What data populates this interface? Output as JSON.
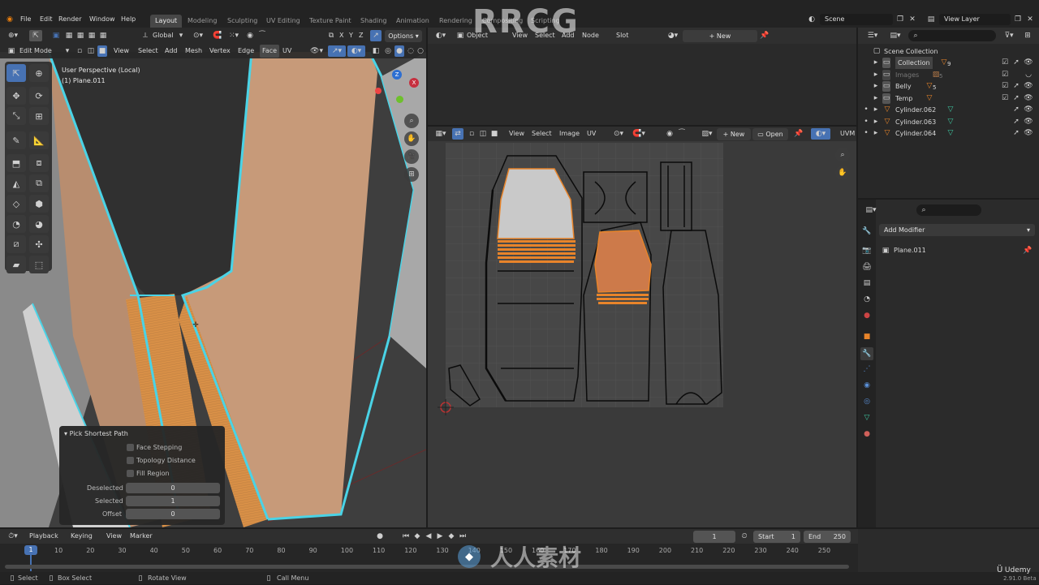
{
  "topbar": {
    "menus": [
      "File",
      "Edit",
      "Render",
      "Window",
      "Help"
    ],
    "tabs": [
      "Layout",
      "Modeling",
      "Sculpting",
      "UV Editing",
      "Texture Paint",
      "Shading",
      "Animation",
      "Rendering",
      "Compositing",
      "Scripting"
    ],
    "active_tab": "Layout",
    "scene": "Scene",
    "view_layer": "View Layer"
  },
  "viewport": {
    "transform_orientation": "Global",
    "options_label": "Options",
    "snap_axes": [
      "X",
      "Y",
      "Z"
    ],
    "mode": "Edit Mode",
    "menus": [
      "View",
      "Select",
      "Add",
      "Mesh",
      "Vertex",
      "Edge",
      "Face",
      "UV"
    ],
    "overlay_title": "User Perspective (Local)",
    "overlay_object": "(1) Plane.011"
  },
  "shader_editor": {
    "type": "Object",
    "menus": [
      "View",
      "Select",
      "Add",
      "Node"
    ],
    "slot_label": "Slot",
    "new_label": "New"
  },
  "uv_editor": {
    "menus": [
      "View",
      "Select",
      "Image",
      "UV"
    ],
    "new_label": "New",
    "open_label": "Open",
    "uv_map": "UVM"
  },
  "operator_panel": {
    "title": "Pick Shortest Path",
    "checkboxes": [
      "Face Stepping",
      "Topology Distance",
      "Fill Region"
    ],
    "fields": [
      {
        "label": "Deselected",
        "value": "0"
      },
      {
        "label": "Selected",
        "value": "1"
      },
      {
        "label": "Offset",
        "value": "0"
      }
    ]
  },
  "outliner": {
    "root": "Scene Collection",
    "items": [
      {
        "name": "Collection",
        "badge": "9",
        "color": "#c8c8c8"
      },
      {
        "name": "Images",
        "badge": "5",
        "color": "#7a7a7a"
      },
      {
        "name": "Belly",
        "badge": "5",
        "color": "#c8c8c8"
      },
      {
        "name": "Temp",
        "badge": "",
        "color": "#c8c8c8"
      },
      {
        "name": "Cylinder.062",
        "badge": "",
        "color": "#c8c8c8"
      },
      {
        "name": "Cylinder.063",
        "badge": "",
        "color": "#c8c8c8"
      },
      {
        "name": "Cylinder.064",
        "badge": "",
        "color": "#c8c8c8"
      }
    ]
  },
  "properties": {
    "add_modifier": "Add Modifier",
    "object": "Plane.011"
  },
  "timeline": {
    "menus": [
      "Playback",
      "Keying",
      "View",
      "Marker"
    ],
    "current_frame": "1",
    "start_label": "Start",
    "start_value": "1",
    "end_label": "End",
    "end_value": "250",
    "ruler_ticks": [
      "10",
      "20",
      "30",
      "40",
      "50",
      "60",
      "70",
      "80",
      "90",
      "100",
      "110",
      "120",
      "130",
      "140",
      "150",
      "160",
      "170",
      "180",
      "190",
      "200",
      "210",
      "220",
      "230",
      "240",
      "250"
    ],
    "playhead_label": "1"
  },
  "statusbar": {
    "items": [
      "Select",
      "Box Select",
      "Rotate View",
      "Call Menu"
    ],
    "version": "2.91.0 Beta"
  },
  "watermarks": {
    "rrcg": "RRCG",
    "cn": "人人素材",
    "udemy": "Udemy"
  },
  "colors": {
    "accent": "#4772b3",
    "selection_orange": "#e8842a",
    "edge_cyan": "#4ad3e6"
  }
}
